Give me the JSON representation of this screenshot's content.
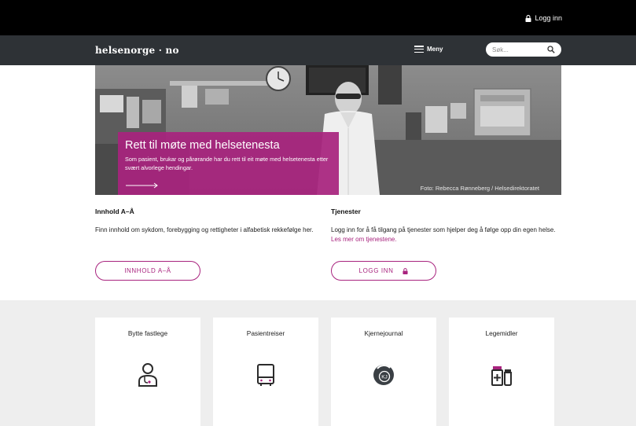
{
  "topbar": {
    "login_label": "Logg inn"
  },
  "header": {
    "logo": "helsenorge · no",
    "menu_label": "Meny",
    "search_placeholder": "Søk..."
  },
  "hero": {
    "title": "Rett til møte med helsetenesta",
    "text": "Som pasient, brukar og pårørande har du rett til eit møte med helsetenesta etter svært alvorlege hendingar.",
    "credit": "Foto: Rebecca Rønneberg / Helsedirektoratet"
  },
  "info": {
    "left": {
      "heading": "Innhold A–Å",
      "text": "Finn innhold om sykdom, forebygging og rettigheter i alfabetisk rekkefølge her.",
      "button": "INNHOLD A–Å"
    },
    "right": {
      "heading": "Tjenester",
      "text": "Logg inn for å få tilgang på tjenester som hjelper deg å følge opp din egen helse.",
      "link": "Les mer om tjenestene.",
      "button": "LOGG INN"
    }
  },
  "cards": [
    {
      "title": "Bytte fastlege",
      "icon": "doctor-icon"
    },
    {
      "title": "Pasientreiser",
      "icon": "bus-icon"
    },
    {
      "title": "Kjernejournal",
      "icon": "kjernejournal-icon"
    },
    {
      "title": "Legemidler",
      "icon": "medicine-icon"
    }
  ],
  "colors": {
    "brand": "#a8237e",
    "topbar": "#000000",
    "header": "#2e3236",
    "section_bg": "#eeeeee"
  }
}
